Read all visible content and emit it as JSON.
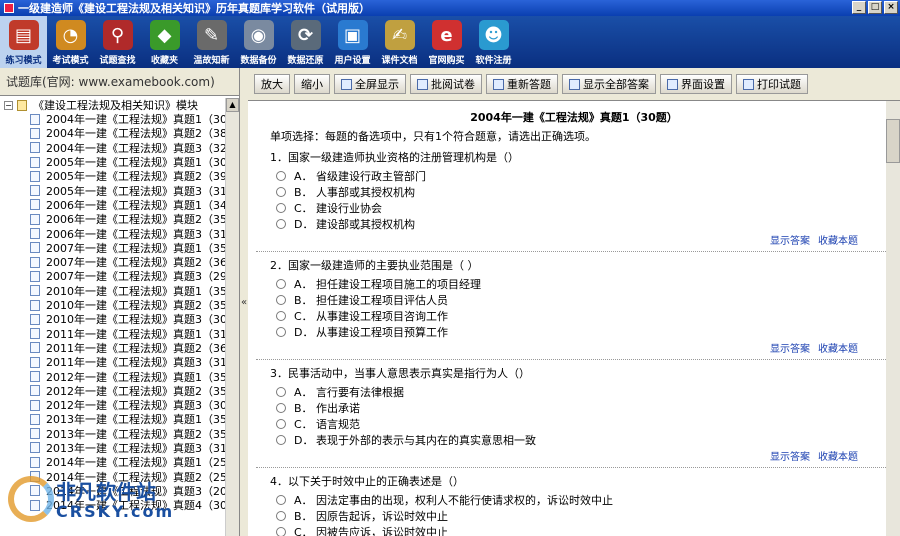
{
  "window": {
    "title": "一级建造师《建设工程法规及相关知识》历年真题库学习软件（试用版）",
    "buttons": [
      "_",
      "□",
      "×"
    ]
  },
  "toolbar": {
    "items": [
      {
        "label": "练习模式",
        "icon": "books-icon",
        "color": "#c03a2a",
        "active": true
      },
      {
        "label": "考试模式",
        "icon": "folder-clock-icon",
        "color": "#d08a20"
      },
      {
        "label": "试题查找",
        "icon": "magnifier-icon",
        "color": "#b02a2a"
      },
      {
        "label": "收藏夹",
        "icon": "green-crystal-icon",
        "color": "#3a9a2a"
      },
      {
        "label": "温故知新",
        "icon": "pencil-icon",
        "color": "#6a6a6a"
      },
      {
        "label": "数据备份",
        "icon": "cd-icon",
        "color": "#7a8aa0"
      },
      {
        "label": "数据还原",
        "icon": "refresh-icon",
        "color": "#5a6a7a"
      },
      {
        "label": "用户设置",
        "icon": "computer-icon",
        "color": "#2a7ad0"
      },
      {
        "label": "课件文档",
        "icon": "document-pen-icon",
        "color": "#c0a040"
      },
      {
        "label": "官网购买",
        "icon": "ie-icon",
        "color": "#d03030"
      },
      {
        "label": "软件注册",
        "icon": "users-icon",
        "color": "#2a9ad0"
      }
    ]
  },
  "left": {
    "header": "试题库(官网: www.examebook.com)",
    "root": "《建设工程法规及相关知识》模块",
    "items": [
      "2004年一建《工程法规》真题1（30题）",
      "2004年一建《工程法规》真题2（38题）",
      "2004年一建《工程法规》真题3（32题）",
      "2005年一建《工程法规》真题1（30题）",
      "2005年一建《工程法规》真题2（39题）",
      "2005年一建《工程法规》真题3（31题）",
      "2006年一建《工程法规》真题1（34题）",
      "2006年一建《工程法规》真题2（35题）",
      "2006年一建《工程法规》真题3（31题）",
      "2007年一建《工程法规》真题1（35题）",
      "2007年一建《工程法规》真题2（36题）",
      "2007年一建《工程法规》真题3（29题）",
      "2010年一建《工程法规》真题1（35题）",
      "2010年一建《工程法规》真题2（35题）",
      "2010年一建《工程法规》真题3（30题）",
      "2011年一建《工程法规》真题1（31题）",
      "2011年一建《工程法规》真题2（36题）",
      "2011年一建《工程法规》真题3（31题）",
      "2012年一建《工程法规》真题1（35题）",
      "2012年一建《工程法规》真题2（35题）",
      "2012年一建《工程法规》真题3（30题）",
      "2013年一建《工程法规》真题1（35题）",
      "2013年一建《工程法规》真题2（35题）",
      "2013年一建《工程法规》真题3（31题）",
      "2014年一建《工程法规》真题1（25题）",
      "2014年一建《工程法规》真题2（25题）",
      "2014年一建《工程法规》真题3（20题）",
      "2014年一建《工程法规》真题4（30题）"
    ]
  },
  "right": {
    "buttons": [
      "放大",
      "缩小",
      "全屏显示",
      "批阅试卷",
      "重新答题",
      "显示全部答案",
      "界面设置",
      "打印试题"
    ],
    "paper_title": "2004年一建《工程法规》真题1（30题）",
    "instructions": "单项选择：每题的备选项中，只有1个符合题意，请选出正确选项。",
    "show_answer": "显示答案",
    "favorite": "收藏本题",
    "questions": [
      {
        "text": "1．国家一级建造师执业资格的注册管理机构是（）",
        "options": [
          {
            "letter": "A．",
            "text": "省级建设行政主管部门"
          },
          {
            "letter": "B．",
            "text": "人事部或其授权机构"
          },
          {
            "letter": "C．",
            "text": "建设行业协会"
          },
          {
            "letter": "D．",
            "text": "建设部或其授权机构"
          }
        ]
      },
      {
        "text": "2．国家一级建造师的主要执业范围是（ ）",
        "options": [
          {
            "letter": "A．",
            "text": "担任建设工程项目施工的项目经理"
          },
          {
            "letter": "B．",
            "text": "担任建设工程项目评估人员"
          },
          {
            "letter": "C．",
            "text": "从事建设工程项目咨询工作"
          },
          {
            "letter": "D．",
            "text": "从事建设工程项目预算工作"
          }
        ]
      },
      {
        "text": "3．民事活动中，当事人意思表示真实是指行为人（）",
        "options": [
          {
            "letter": "A．",
            "text": "言行要有法律根据"
          },
          {
            "letter": "B．",
            "text": "作出承诺"
          },
          {
            "letter": "C．",
            "text": "语言规范"
          },
          {
            "letter": "D．",
            "text": "表现于外部的表示与其内在的真实意思相一致"
          }
        ]
      },
      {
        "text": "4．以下关于时效中止的正确表述是（）",
        "options": [
          {
            "letter": "A．",
            "text": "因法定事由的出现，权利人不能行使请求权的，诉讼时效中止"
          },
          {
            "letter": "B．",
            "text": "因原告起诉，诉讼时效中止"
          },
          {
            "letter": "C．",
            "text": "因被告应诉，诉讼时效中止"
          }
        ]
      }
    ]
  },
  "watermark": {
    "line1": "非凡软件站",
    "line2": "CRSKY.com"
  }
}
